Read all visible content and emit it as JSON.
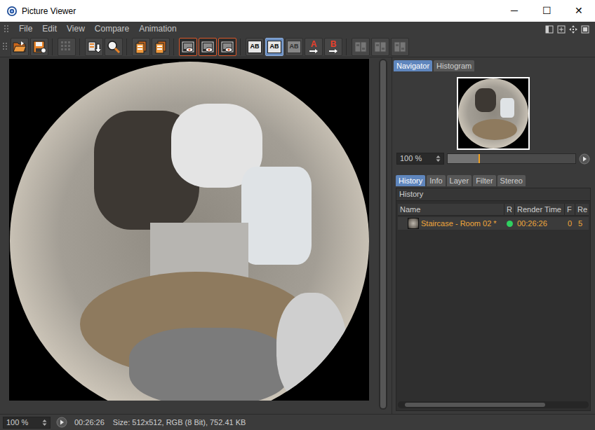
{
  "window": {
    "title": "Picture Viewer",
    "controls": [
      "─",
      "☐",
      "✕"
    ]
  },
  "menu": [
    "File",
    "Edit",
    "View",
    "Compare",
    "Animation"
  ],
  "toolbar": [
    {
      "kind": "open",
      "label": "",
      "selected": false,
      "disabled": false
    },
    {
      "kind": "save",
      "label": "",
      "selected": false,
      "disabled": false
    },
    {
      "kind": "separator"
    },
    {
      "kind": "grid",
      "label": "",
      "selected": false,
      "disabled": true
    },
    {
      "kind": "separator"
    },
    {
      "kind": "export",
      "label": "",
      "selected": false,
      "disabled": false
    },
    {
      "kind": "zoom",
      "label": "",
      "selected": false,
      "disabled": false
    },
    {
      "kind": "separator"
    },
    {
      "kind": "delete",
      "label": "",
      "selected": false,
      "disabled": false
    },
    {
      "kind": "delete",
      "label": "",
      "selected": false,
      "disabled": false
    },
    {
      "kind": "separator"
    },
    {
      "kind": "view",
      "label": "",
      "selected": true,
      "disabled": false
    },
    {
      "kind": "view",
      "label": "",
      "selected": true,
      "disabled": false
    },
    {
      "kind": "view",
      "label": "",
      "selected": true,
      "disabled": false
    },
    {
      "kind": "separator"
    },
    {
      "kind": "compare",
      "label": "AB",
      "selected": false,
      "disabled": false
    },
    {
      "kind": "compare",
      "label": "AB",
      "selected": true,
      "disabled": false
    },
    {
      "kind": "compare",
      "label": "AB",
      "selected": false,
      "disabled": true
    },
    {
      "kind": "swap",
      "label": "A",
      "selected": false,
      "disabled": false
    },
    {
      "kind": "swap",
      "label": "B",
      "selected": false,
      "disabled": false
    },
    {
      "kind": "separator"
    },
    {
      "kind": "split",
      "label": "",
      "selected": false,
      "disabled": true
    },
    {
      "kind": "split",
      "label": "",
      "selected": false,
      "disabled": true
    },
    {
      "kind": "split",
      "label": "",
      "selected": false,
      "disabled": true
    }
  ],
  "navigator": {
    "tabs": [
      {
        "label": "Navigator",
        "selected": true
      },
      {
        "label": "Histogram",
        "selected": false
      }
    ],
    "zoom": "100 %",
    "level": 0.25
  },
  "history": {
    "tabs": [
      {
        "label": "History",
        "selected": true
      },
      {
        "label": "Info",
        "selected": false
      },
      {
        "label": "Layer",
        "selected": false
      },
      {
        "label": "Filter",
        "selected": false
      },
      {
        "label": "Stereo",
        "selected": false
      }
    ],
    "title": "History",
    "columns": [
      "Name",
      "R",
      "Render Time",
      "F",
      "Re"
    ],
    "rows": [
      {
        "name": "Staircase - Room 02 *",
        "color": "#2fd160",
        "render_time": "00:26:26",
        "frame": "0",
        "res": "5",
        "selected": true
      }
    ]
  },
  "status_bar": {
    "zoom": "100 %",
    "time": "00:26:26",
    "info": "Size: 512x512, RGB (8 Bit), 752.41 KB"
  }
}
